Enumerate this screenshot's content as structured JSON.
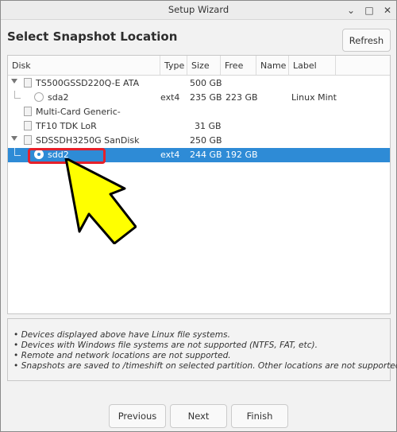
{
  "window": {
    "title": "Setup Wizard",
    "min_glyph": "⌄",
    "max_glyph": "□",
    "close_glyph": "✕"
  },
  "header": {
    "title": "Select Snapshot Location",
    "refresh_label": "Refresh"
  },
  "table": {
    "columns": [
      "Disk",
      "Type",
      "Size",
      "Free",
      "Name",
      "Label"
    ],
    "rows": [
      {
        "disk": "TS500GSSD220Q-E ATA",
        "type": "",
        "size": "500 GB",
        "free": "",
        "name": "",
        "label": "",
        "kind": "disk",
        "expanded": true
      },
      {
        "disk": "sda2",
        "type": "ext4",
        "size": "235 GB",
        "free": "223 GB",
        "name": "",
        "label": "Linux Mint",
        "kind": "partition",
        "selected": false
      },
      {
        "disk": "Multi-Card Generic-",
        "type": "",
        "size": "",
        "free": "",
        "name": "",
        "label": "",
        "kind": "disk"
      },
      {
        "disk": "TF10 TDK LoR",
        "type": "",
        "size": "31 GB",
        "free": "",
        "name": "",
        "label": "",
        "kind": "disk"
      },
      {
        "disk": "SDSSDH3250G SanDisk",
        "type": "",
        "size": "250 GB",
        "free": "",
        "name": "",
        "label": "",
        "kind": "disk",
        "expanded": true
      },
      {
        "disk": "sdd2",
        "type": "ext4",
        "size": "244 GB",
        "free": "192 GB",
        "name": "",
        "label": "",
        "kind": "partition",
        "selected": true
      }
    ]
  },
  "notes": [
    "• Devices displayed above have Linux file systems.",
    "• Devices with Windows file systems are not supported (NTFS, FAT, etc).",
    "• Remote and network locations are not supported.",
    "• Snapshots are saved to /timeshift on selected partition. Other locations are not supported."
  ],
  "footer": {
    "previous_label": "Previous",
    "next_label": "Next",
    "finish_label": "Finish"
  },
  "colors": {
    "selection": "#2e8bd6",
    "highlight_box": "#e6202a",
    "arrow_fill": "#ffff00"
  }
}
